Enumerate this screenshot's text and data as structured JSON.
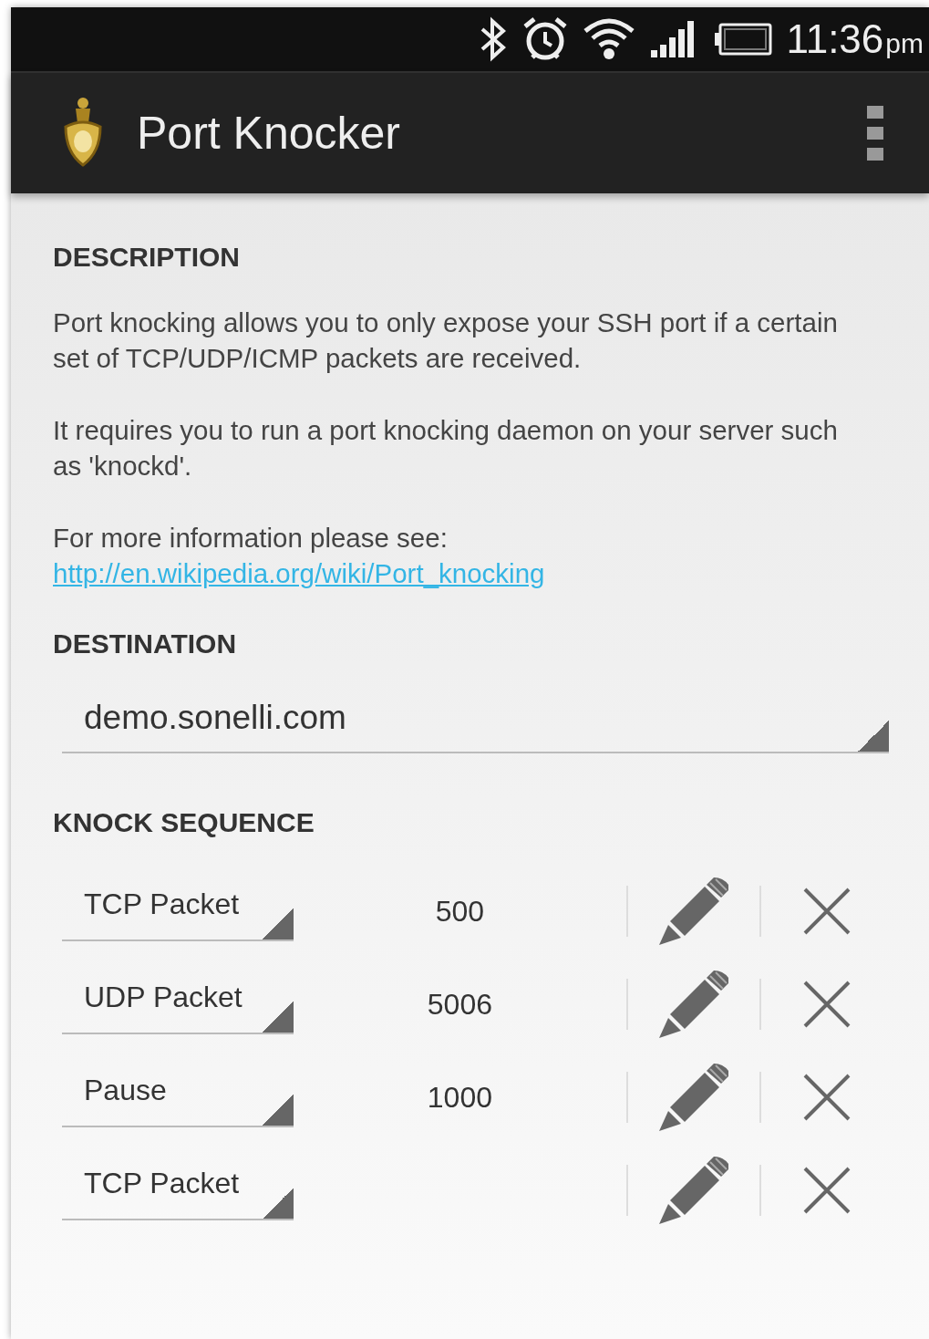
{
  "status_bar": {
    "time": "11:36",
    "period": "pm"
  },
  "action_bar": {
    "title": "Port Knocker"
  },
  "description": {
    "heading": "DESCRIPTION",
    "paragraphs": [
      "Port knocking allows you to only expose your SSH port if a certain set of TCP/UDP/ICMP packets are received.",
      "It requires you to run a port knocking daemon on your server such as 'knockd'.",
      "For more information please see:"
    ],
    "link": "http://en.wikipedia.org/wiki/Port_knocking"
  },
  "destination": {
    "heading": "DESTINATION",
    "value": "demo.sonelli.com"
  },
  "knock_sequence": {
    "heading": "KNOCK SEQUENCE",
    "rows": [
      {
        "type": "TCP Packet",
        "value": "500"
      },
      {
        "type": "UDP Packet",
        "value": "5006"
      },
      {
        "type": "Pause",
        "value": "1000"
      },
      {
        "type": "TCP Packet"
      }
    ]
  }
}
